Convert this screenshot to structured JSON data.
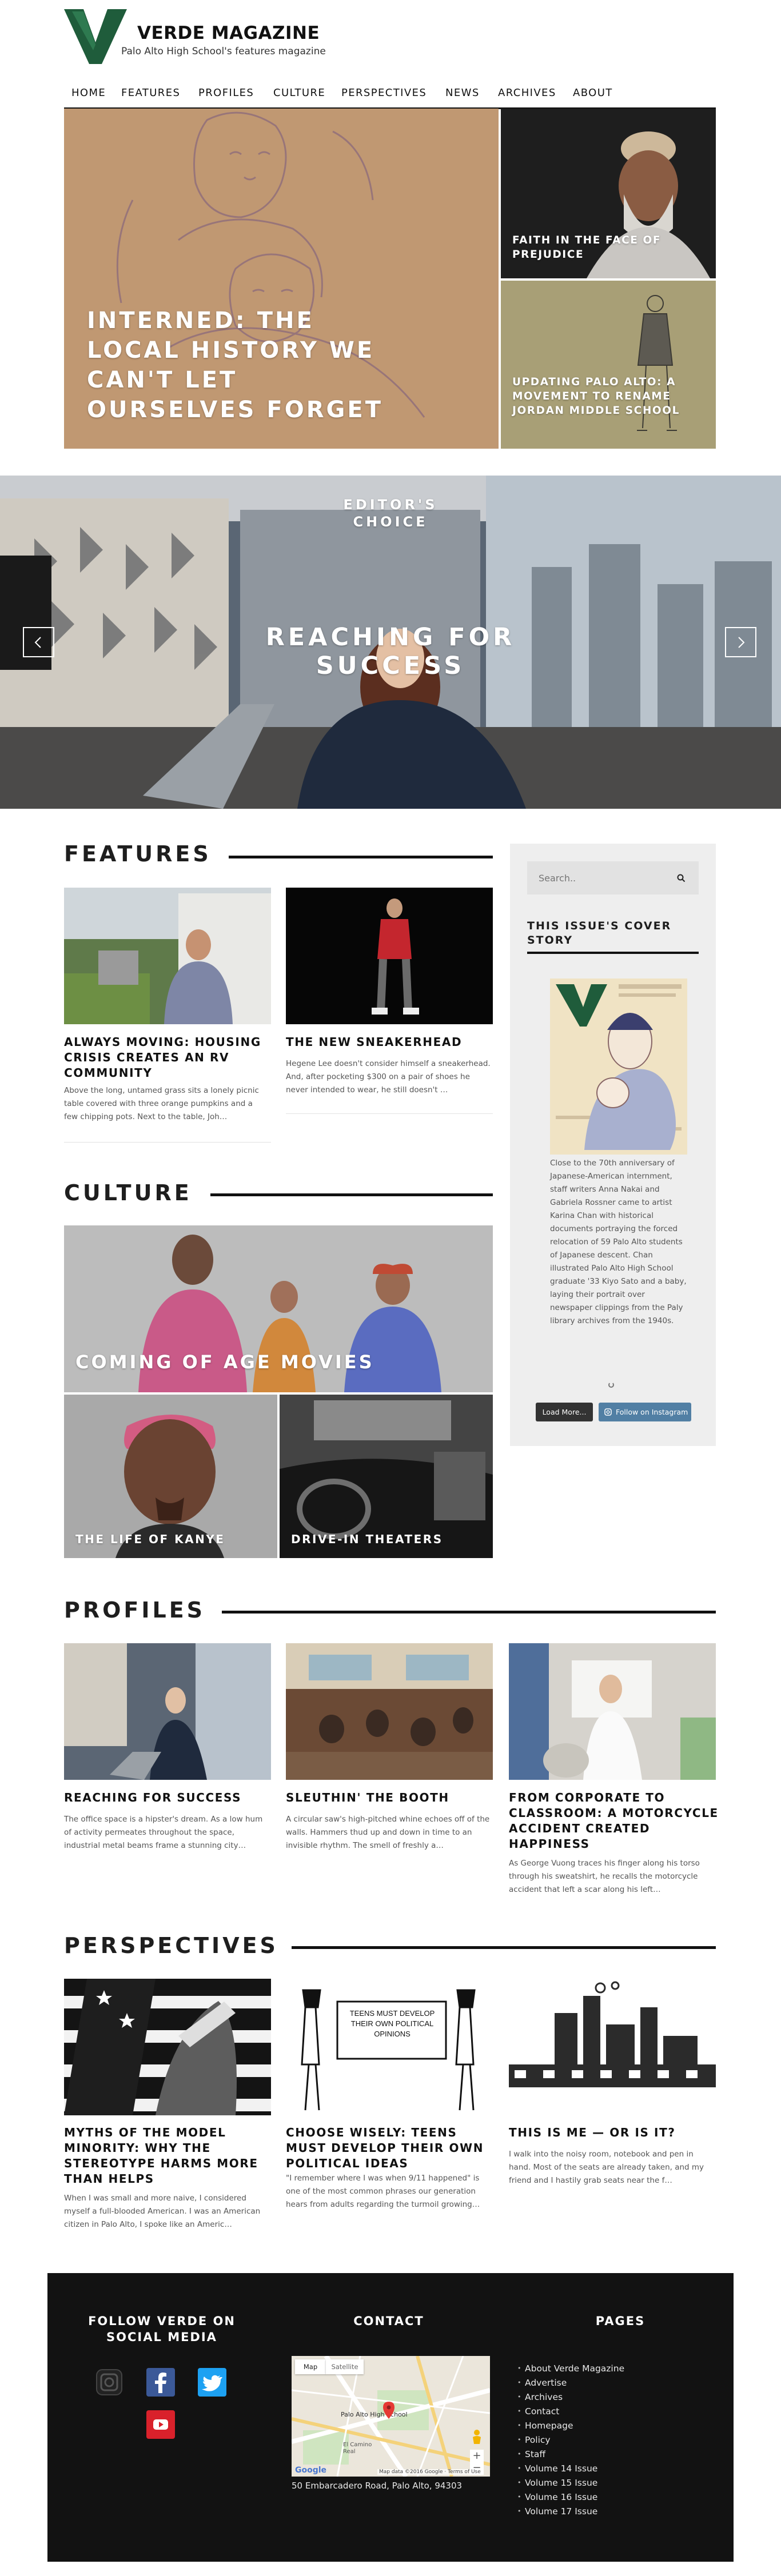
{
  "site": {
    "name": "VERDE MAGAZINE",
    "tagline": "Palo Alto High School's features magazine",
    "logo_letter": "V",
    "accent": "#1f5c3b"
  },
  "nav": [
    "HOME",
    "FEATURES",
    "PROFILES",
    "CULTURE",
    "PERSPECTIVES",
    "NEWS",
    "ARCHIVES",
    "ABOUT"
  ],
  "hero": {
    "main": "INTERNED: THE LOCAL HISTORY WE CAN'T LET OURSELVES FORGET",
    "side1": "FAITH IN THE FACE OF PREJUDICE",
    "side2": "UPDATING PALO ALTO: A MOVEMENT TO RENAME JORDAN MIDDLE SCHOOL"
  },
  "editors": {
    "label": "EDITOR'S CHOICE",
    "title": "REACHING FOR SUCCESS",
    "prev_icon": "chevron-left-icon",
    "next_icon": "chevron-right-icon"
  },
  "features": {
    "heading": "FEATURES",
    "articles": [
      {
        "title": "ALWAYS MOVING: HOUSING CRISIS CREATES AN RV COMMUNITY",
        "excerpt": "Above the long, untamed grass sits a lonely picnic table covered with three orange pumpkins and a few chipping pots. Next to the table, Joh…"
      },
      {
        "title": "THE NEW SNEAKERHEAD",
        "excerpt": "Hegene Lee doesn't consider himself a sneakerhead. And, after pocketing $300 on a pair of shoes he never intended to wear, he still doesn't …"
      }
    ]
  },
  "sidebar": {
    "search_placeholder": "Search..",
    "search_icon": "search-icon",
    "cover_heading": "THIS ISSUE'S COVER STORY",
    "cover_text": "Close to the 70th anniversary of Japanese-American internment, staff writers Anna Nakai and Gabriela Rossner came to artist Karina Chan with historical documents portraying the forced relocation of 59 Palo Alto students of Japanese descent. Chan illustrated Palo Alto High School graduate '33 Kiyo Sato and a baby, laying their portrait over newspaper clippings from the Paly library archives from the 1940s.",
    "load_more": "Load More...",
    "follow_instagram": "Follow on Instagram"
  },
  "culture": {
    "heading": "CULTURE",
    "big": "COMING OF AGE MOVIES",
    "small1": "THE LIFE OF KANYE",
    "small2": "DRIVE-IN THEATERS"
  },
  "profiles": {
    "heading": "PROFILES",
    "articles": [
      {
        "title": "REACHING FOR SUCCESS",
        "excerpt": "The office space is a hipster's dream. As a low hum of activity permeates throughout the space, industrial metal beams frame a stunning city…"
      },
      {
        "title": "SLEUTHIN' THE BOOTH",
        "excerpt": "A circular saw's high-pitched whine echoes off of the walls. Hammers thud up and down in time to an invisible rhythm. The smell of freshly a…"
      },
      {
        "title": "FROM CORPORATE TO CLASSROOM: A MOTORCYCLE ACCIDENT CREATED HAPPINESS",
        "excerpt": "As George Vuong traces his finger along his torso through his sweatshirt, he recalls the motorcycle accident that left a scar along his left…"
      }
    ]
  },
  "perspectives": {
    "heading": "PERSPECTIVES",
    "sign_text": "TEENS MUST DEVELOP THEIR OWN POLITICAL OPINIONS",
    "articles": [
      {
        "title": "MYTHS OF THE MODEL MINORITY: WHY THE STEREOTYPE HARMS MORE THAN HELPS",
        "excerpt": "When I was small and more naive, I considered myself a full-blooded American. I was an American citizen in Palo Alto, I spoke like an Americ…"
      },
      {
        "title": "CHOOSE WISELY: TEENS MUST DEVELOP THEIR OWN POLITICAL IDEAS",
        "excerpt": "\"I remember where I was when 9/11 happened\" is one of the most common phrases our generation hears from adults regarding the turmoil growing…"
      },
      {
        "title": "THIS IS ME — OR IS IT?",
        "excerpt": "I walk into the noisy room, notebook and pen in hand. Most of the seats are already taken, and my friend and I hastily grab seats near the f…"
      }
    ]
  },
  "footer": {
    "social_heading": "FOLLOW VERDE ON SOCIAL MEDIA",
    "social_icons": [
      "instagram-icon",
      "facebook-icon",
      "twitter-icon",
      "youtube-icon"
    ],
    "contact_heading": "CONTACT",
    "map": {
      "tab_map": "Map",
      "tab_satellite": "Satellite",
      "place": "Palo Alto High School",
      "road": "El Camino Real",
      "brand": "Google",
      "credit": "Map data ©2016 Google · Terms of Use"
    },
    "address": "50 Embarcadero Road, Palo Alto, 94303",
    "pages_heading": "PAGES",
    "pages": [
      "About Verde Magazine",
      "Advertise",
      "Archives",
      "Contact",
      "Homepage",
      "Policy",
      "Staff",
      "Volume 14 Issue",
      "Volume 15 Issue",
      "Volume 16 Issue",
      "Volume 17 Issue"
    ]
  }
}
